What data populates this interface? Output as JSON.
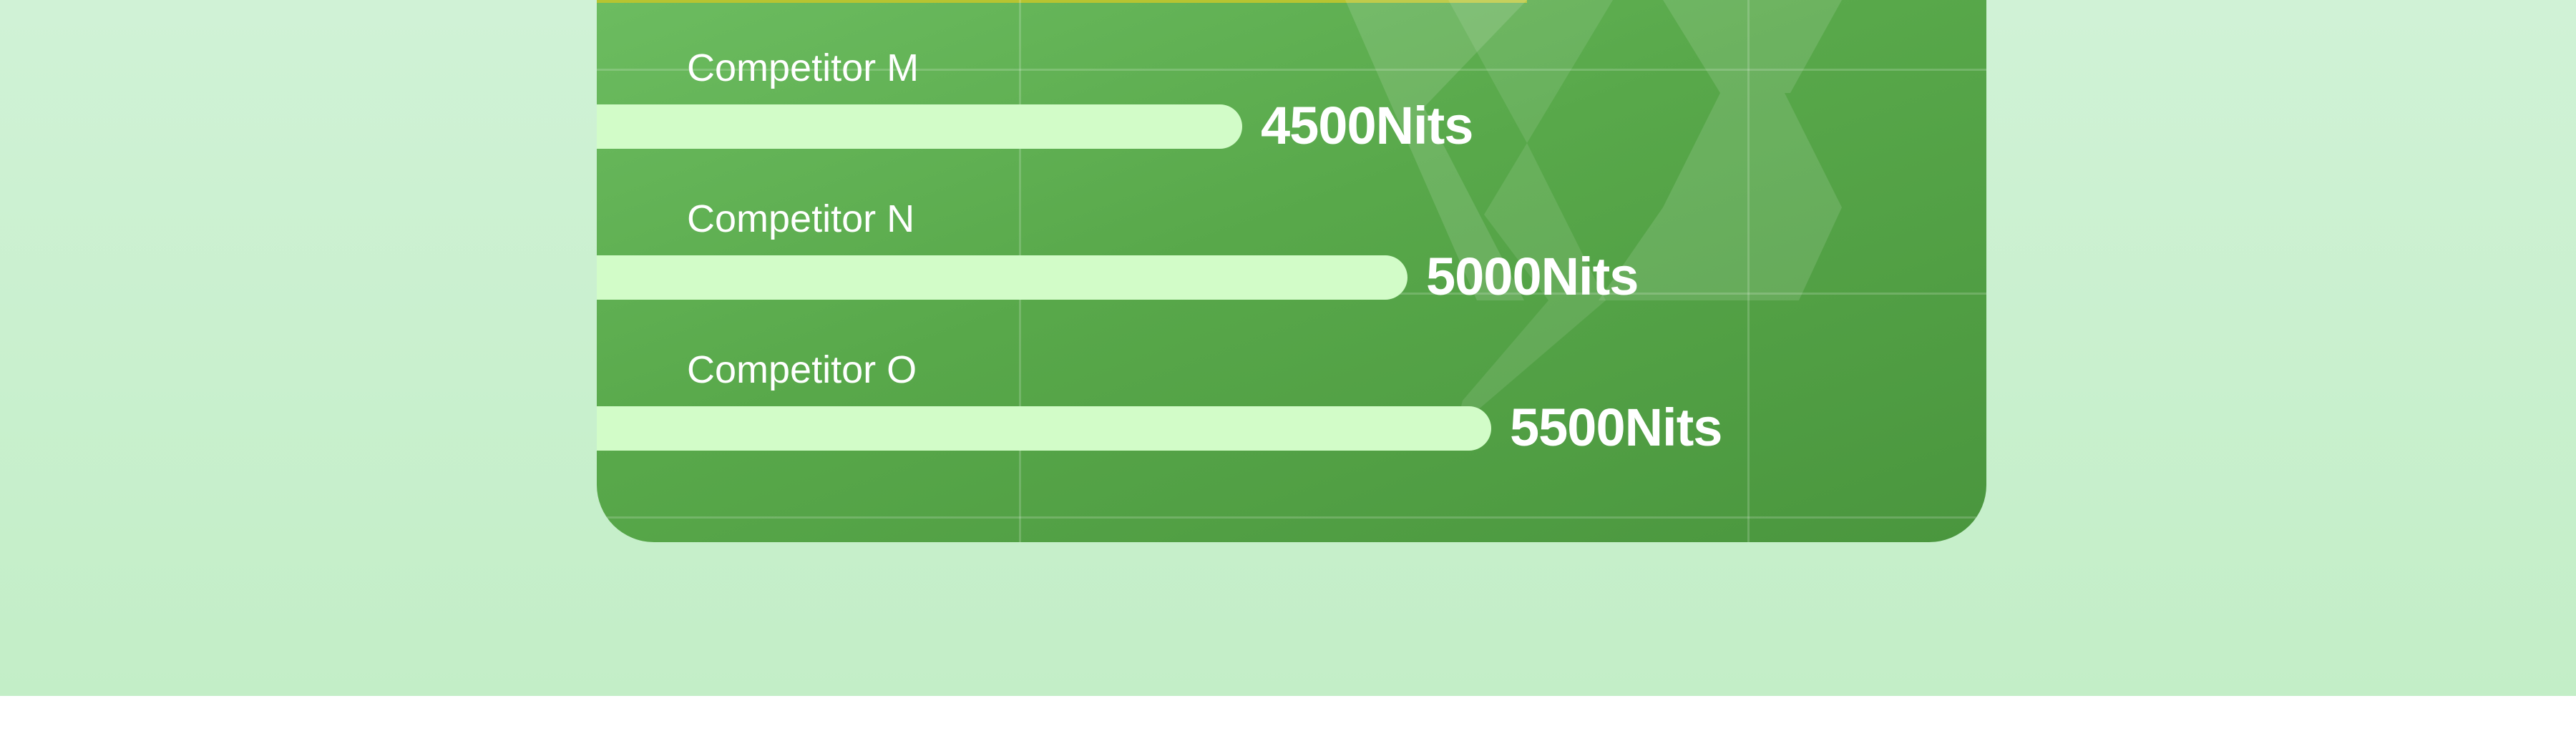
{
  "chart_data": {
    "type": "bar",
    "orientation": "horizontal",
    "categories": [
      "Competitor M",
      "Competitor N",
      "Competitor O"
    ],
    "values": [
      4500,
      5000,
      5500
    ],
    "value_labels": [
      "4500Nits",
      "5000Nits",
      "5500Nits"
    ],
    "unit": "Nits",
    "title": "",
    "xlabel": "",
    "ylabel": "",
    "grid": true
  },
  "colors": {
    "background": "#cdf1d3",
    "card": "#58a84a",
    "bar": "#d2fcc8",
    "text": "#ffffff",
    "accent_line": "#b7c431"
  }
}
